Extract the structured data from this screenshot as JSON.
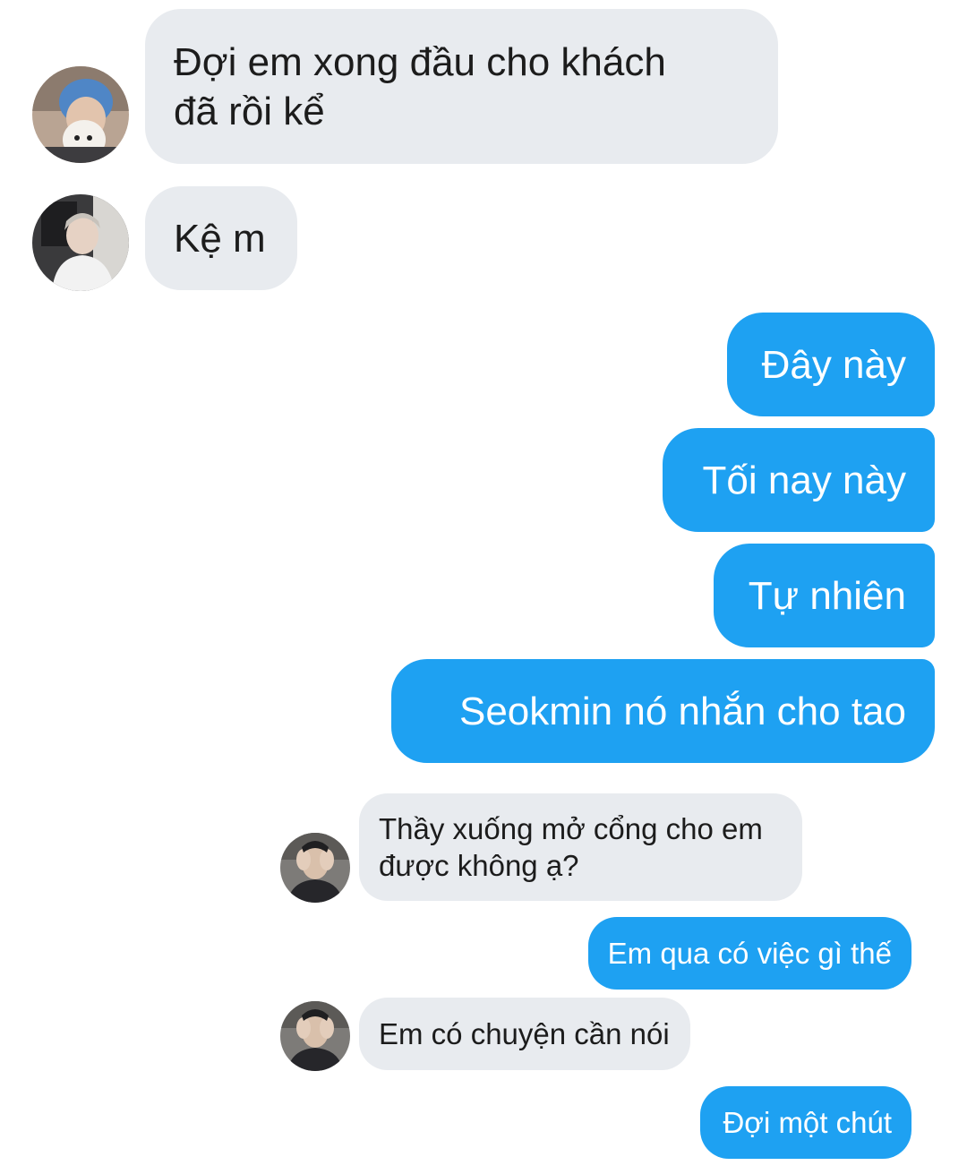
{
  "conversation": {
    "messages": [
      {
        "sender": "incoming",
        "avatar": "blue-hair-avatar",
        "lines": [
          "Đợi em xong đầu cho khách",
          "đã rồi kể"
        ]
      },
      {
        "sender": "incoming",
        "avatar": "white-shirt-avatar",
        "text": "Kệ m"
      },
      {
        "sender": "outgoing",
        "text": "Đây này"
      },
      {
        "sender": "outgoing",
        "text": "Tối nay này"
      },
      {
        "sender": "outgoing",
        "text": "Tự nhiên"
      },
      {
        "sender": "outgoing",
        "text": "Seokmin nó nhắn cho tao"
      }
    ],
    "embedded_screenshot": {
      "messages": [
        {
          "sender": "incoming",
          "avatar": "hands-face-avatar",
          "lines": [
            "Thầy xuống mở cổng cho em",
            "được không ạ?"
          ]
        },
        {
          "sender": "outgoing",
          "text": "Em qua có việc gì thế"
        },
        {
          "sender": "incoming",
          "avatar": "hands-face-avatar",
          "text": "Em có chuyện cần nói"
        },
        {
          "sender": "outgoing",
          "text": "Đợi một chút"
        }
      ]
    }
  },
  "colors": {
    "incoming_bubble": "#e8ebef",
    "outgoing_bubble": "#1ea1f2",
    "incoming_text": "#1c1c1c",
    "outgoing_text": "#ffffff"
  }
}
